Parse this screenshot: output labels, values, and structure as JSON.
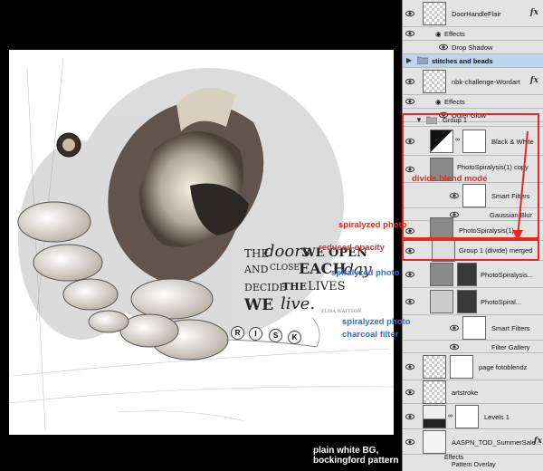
{
  "layers": [
    {
      "name": "DoorHandleFlair",
      "fx": "fx"
    },
    {
      "name": "Effects"
    },
    {
      "name": "Drop Shadow"
    },
    {
      "name": "stitches and beads"
    },
    {
      "name": "nbk-challenge-Wordart",
      "fx": "fx"
    },
    {
      "name": "Effects"
    },
    {
      "name": "Outer Glow"
    },
    {
      "name": "Group 1"
    },
    {
      "name": "Black & White"
    },
    {
      "name": "PhotoSpiralysis(1) copy"
    },
    {
      "name": "Smart Filters"
    },
    {
      "name": "Gaussian Blur"
    },
    {
      "name": "PhotoSpiralysis(1)"
    },
    {
      "name": "Group 1 (divide) merged"
    },
    {
      "name": "PhotoSpiralysis..."
    },
    {
      "name": "PhotoSpiral..."
    },
    {
      "name": "Smart Filters"
    },
    {
      "name": "Filter Gallery"
    },
    {
      "name": "page fotoblendz"
    },
    {
      "name": "artstroke"
    },
    {
      "name": "Levels 1"
    },
    {
      "name": "AASPN_TOD_SummerSale..."
    },
    {
      "name": "Effects"
    },
    {
      "name": "Pattern Overlay"
    }
  ],
  "wordart": {
    "w1": "THE",
    "w2": "doors",
    "w3": "WE OPEN",
    "w4": "AND",
    "w5": "CLOSE",
    "w6": "EACH",
    "w7": "day",
    "w8": "DECIDE",
    "w9": "THE",
    "w10": "LIVES",
    "w11": "WE",
    "w12": "live.",
    "credit": "ELISA WATTSON"
  },
  "beads": [
    "R",
    "I",
    "S",
    "K"
  ],
  "annotations": {
    "divide": "divide blend mode",
    "spiral1": "spiralyzed photo",
    "opacity": "reduced opacity",
    "spiral2": "spiralyzed photo",
    "spiral3": "spiralyzed photo",
    "charcoal": "charcoal filter",
    "bottom": "plain white BG, bockingford pattern"
  },
  "colors": {
    "annotation_red": "#e8291f",
    "annotation_blue": "#2b6ff0",
    "selection": "#bcd4f0",
    "panel": "#e3e3e3"
  }
}
